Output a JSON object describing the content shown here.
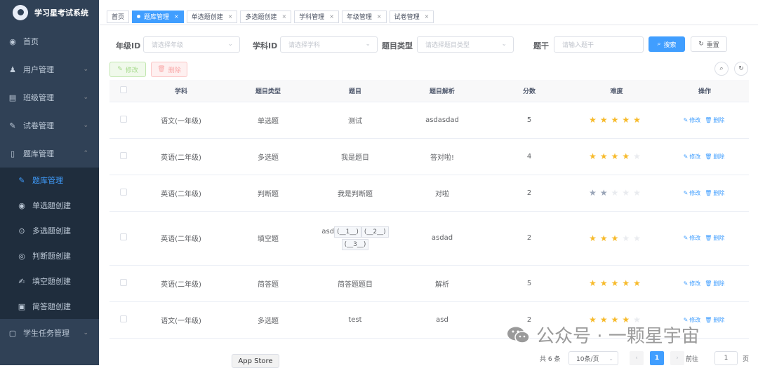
{
  "app": {
    "title": "学习星考试系统"
  },
  "sidebar": {
    "items": [
      {
        "label": "首页",
        "icon": "dashboard-icon",
        "has_arrow": false
      },
      {
        "label": "用户管理",
        "icon": "user-icon",
        "has_arrow": true
      },
      {
        "label": "班级管理",
        "icon": "class-icon",
        "has_arrow": true
      },
      {
        "label": "试卷管理",
        "icon": "paper-icon",
        "has_arrow": true
      },
      {
        "label": "题库管理",
        "icon": "book-icon",
        "has_arrow": true,
        "expanded": true
      }
    ],
    "sub_items": [
      {
        "label": "题库管理",
        "active": true
      },
      {
        "label": "单选题创建"
      },
      {
        "label": "多选题创建"
      },
      {
        "label": "判断题创建"
      },
      {
        "label": "填空题创建"
      },
      {
        "label": "简答题创建"
      }
    ],
    "last_item": {
      "label": "学生任务管理"
    }
  },
  "tags": [
    {
      "label": "首页",
      "active": false,
      "closable": false
    },
    {
      "label": "题库管理",
      "active": true,
      "closable": true
    },
    {
      "label": "单选题创建",
      "active": false,
      "closable": true
    },
    {
      "label": "多选题创建",
      "active": false,
      "closable": true
    },
    {
      "label": "学科管理",
      "active": false,
      "closable": true
    },
    {
      "label": "年级管理",
      "active": false,
      "closable": true
    },
    {
      "label": "试卷管理",
      "active": false,
      "closable": true
    }
  ],
  "filters": {
    "grade_label": "年级ID",
    "grade_placeholder": "请选择年级",
    "subject_label": "学科ID",
    "subject_placeholder": "请选择学科",
    "type_label": "题目类型",
    "type_placeholder": "请选择题目类型",
    "stem_label": "题干",
    "stem_placeholder": "请输入题干",
    "search_label": "搜索",
    "reset_label": "重置"
  },
  "toolbar": {
    "edit_label": "修改",
    "delete_label": "删除"
  },
  "table": {
    "columns": [
      "学科",
      "题目类型",
      "题目",
      "题目解析",
      "分数",
      "难度",
      "操作"
    ],
    "rows": [
      {
        "subject": "语文(一年级)",
        "type": "单选题",
        "title": "测试",
        "analysis": "asdasdad",
        "score": "5",
        "difficulty": 5
      },
      {
        "subject": "英语(二年级)",
        "type": "多选题",
        "title": "我是题目",
        "analysis": "答对啦!",
        "score": "4",
        "difficulty": 4
      },
      {
        "subject": "英语(二年级)",
        "type": "判断题",
        "title": "我是判断题",
        "analysis": "对啦",
        "score": "2",
        "difficulty": 2
      },
      {
        "subject": "英语(二年级)",
        "type": "填空题",
        "title": "asd",
        "blanks": [
          "(__1__)",
          "(__2__)",
          "(__3__)"
        ],
        "analysis": "asdad",
        "score": "2",
        "difficulty": 3
      },
      {
        "subject": "英语(二年级)",
        "type": "简答题",
        "title": "简答题题目",
        "analysis": "解析",
        "score": "5",
        "difficulty": 5
      },
      {
        "subject": "语文(一年级)",
        "type": "多选题",
        "title": "test",
        "analysis": "asd",
        "score": "2",
        "difficulty": 4
      }
    ],
    "row_edit": "修改",
    "row_delete": "删除"
  },
  "pagination": {
    "total": "共 6 条",
    "page_size": "10条/页",
    "current": "1",
    "goto_label": "前往",
    "goto_value": "1",
    "page_suffix": "页"
  },
  "overlay": {
    "app_store": "App Store",
    "watermark": "公众号 · 一颗星宇宙"
  },
  "colors": {
    "primary": "#409eff",
    "sidebar": "#304156",
    "star": "#f7ba2a"
  }
}
